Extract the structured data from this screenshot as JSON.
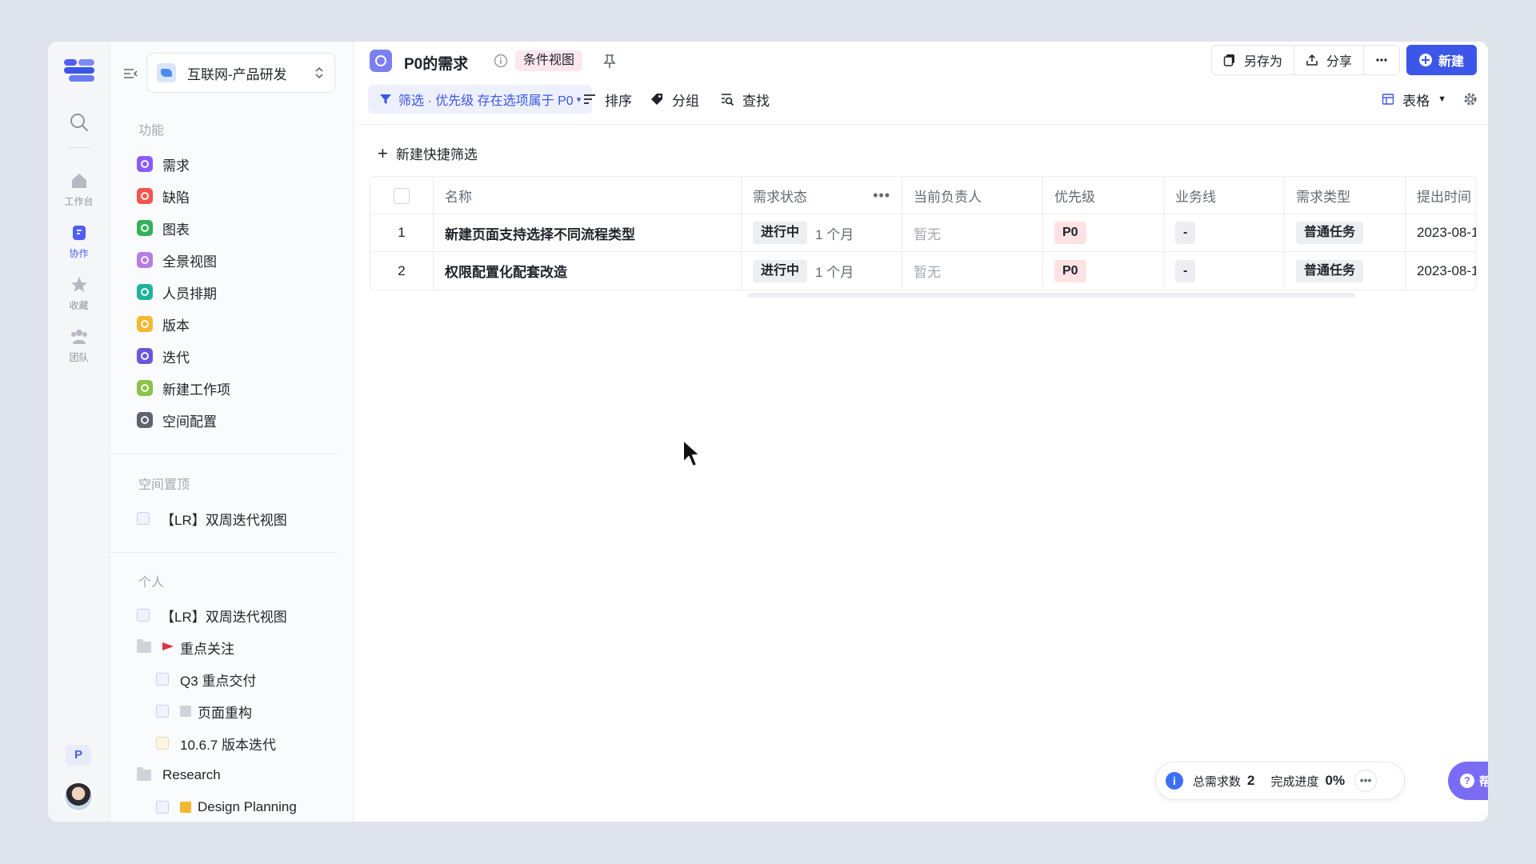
{
  "rail": {
    "items": [
      {
        "label": "工作台",
        "icon": "home-icon"
      },
      {
        "label": "协作",
        "icon": "collab-icon"
      },
      {
        "label": "收藏",
        "icon": "star-icon"
      },
      {
        "label": "团队",
        "icon": "team-icon"
      }
    ],
    "user_badge": "P"
  },
  "sidebar": {
    "workspace": "互联网-产品研发",
    "section_features": "功能",
    "features": [
      {
        "label": "需求",
        "color": "#8a5cf6"
      },
      {
        "label": "缺陷",
        "color": "#f2564d"
      },
      {
        "label": "图表",
        "color": "#34b25a"
      },
      {
        "label": "全景视图",
        "color": "#b77be8"
      },
      {
        "label": "人员排期",
        "color": "#20b39b"
      },
      {
        "label": "版本",
        "color": "#f5b731"
      },
      {
        "label": "迭代",
        "color": "#6c55d9"
      },
      {
        "label": "新建工作项",
        "color": "#8bc34a"
      },
      {
        "label": "空间配置",
        "color": "#5e646e"
      }
    ],
    "section_pinned": "空间置顶",
    "pinned": [
      {
        "label": "【LR】双周迭代视图"
      }
    ],
    "section_personal": "个人",
    "personal": [
      {
        "label": "【LR】双周迭代视图"
      },
      {
        "label": "重点关注"
      },
      {
        "label": "Q3 重点交付"
      },
      {
        "label": "页面重构"
      },
      {
        "label": "10.6.7 版本迭代"
      },
      {
        "label": "Research"
      },
      {
        "label": "Design Planning"
      }
    ]
  },
  "header": {
    "title": "P0的需求",
    "view_badge": "条件视图",
    "save_as": "另存为",
    "share": "分享",
    "new_button": "新建"
  },
  "toolbar": {
    "filter": "筛选 · 优先级 存在选项属于 P0",
    "sort": "排序",
    "group": "分组",
    "find": "查找",
    "view": "表格"
  },
  "quick_filter": "新建快捷筛选",
  "table": {
    "columns": [
      "名称",
      "需求状态",
      "当前负责人",
      "优先级",
      "业务线",
      "需求类型",
      "提出时间"
    ],
    "rows": [
      {
        "index": "1",
        "name": "新建页面支持选择不同流程类型",
        "status": "进行中",
        "duration": "1 个月",
        "owner": "暂无",
        "priority": "P0",
        "line": "-",
        "type": "普通任务",
        "time": "2023-08-1"
      },
      {
        "index": "2",
        "name": "权限配置化配套改造",
        "status": "进行中",
        "duration": "1 个月",
        "owner": "暂无",
        "priority": "P0",
        "line": "-",
        "type": "普通任务",
        "time": "2023-08-1"
      }
    ]
  },
  "summary": {
    "total_label": "总需求数",
    "total_value": "2",
    "progress_label": "完成进度",
    "progress_value": "0%"
  },
  "help": "帮助",
  "colors": {
    "primary": "#3b56e8",
    "help": "#7b6cf6",
    "priority_tag": "#fde2e4",
    "view_badge": "#fde7ef"
  }
}
